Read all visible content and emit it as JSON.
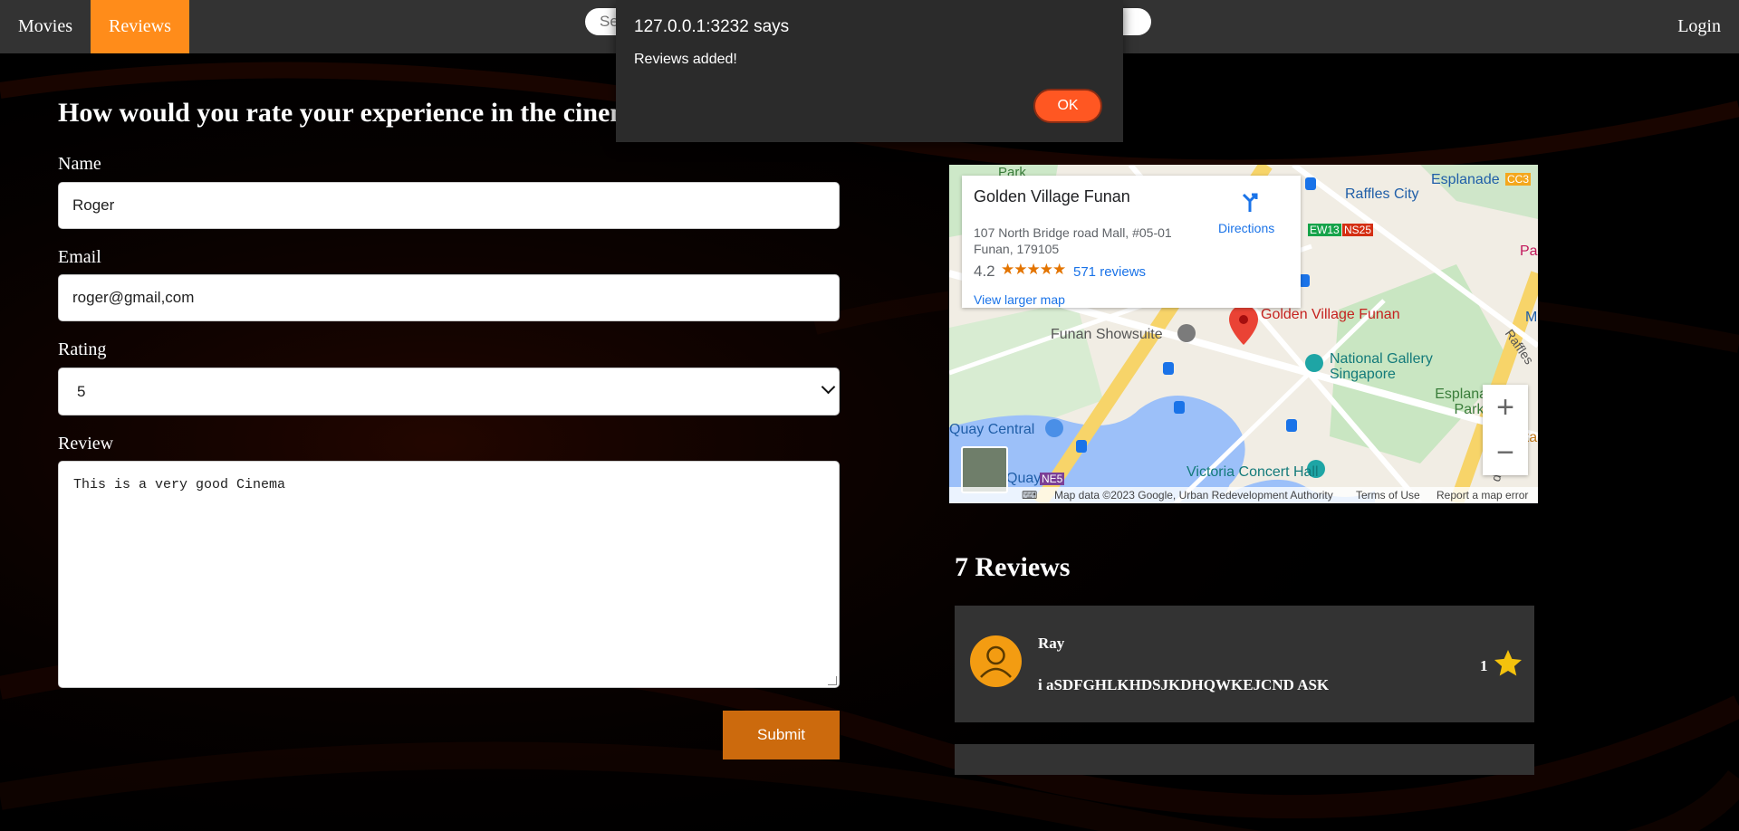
{
  "nav": {
    "movies": "Movies",
    "reviews": "Reviews",
    "login": "Login",
    "search_placeholder": "Search"
  },
  "form": {
    "heading": "How would you rate your experience in the cinema?",
    "name_label": "Name",
    "name_value": "Roger",
    "email_label": "Email",
    "email_value": "roger@gmail,com",
    "rating_label": "Rating",
    "rating_value": "5",
    "review_label": "Review",
    "review_value": "This is a very good Cinema",
    "submit": "Submit"
  },
  "map": {
    "place_name": "Golden Village Funan",
    "address": "107 North Bridge road Mall, #05-01 Funan, 179105",
    "rating": "4.2",
    "stars": "★★★★★",
    "reviews_link": "571 reviews",
    "directions": "Directions",
    "view_larger": "View larger map",
    "labels": {
      "park": "Park",
      "esplanade": "Esplanade",
      "cc3": "CC3",
      "raffles_city": "Raffles City",
      "ew13": "EW13",
      "ns25": "NS25",
      "pa": "Pa",
      "golden_village": "Golden Village Funan",
      "funan": "Funan Showsuite",
      "national_gallery": "National Gallery Singapore",
      "raffles": "Raffles",
      "m": "M",
      "esplanade_park": "Esplanade Park",
      "quay_central": "Quay Central",
      "victoria": "Victoria Concert Hall",
      "maka": "Maka",
      "quay": "Quay",
      "ne5": "NE5",
      "de_dr": "de Dr"
    },
    "attribution": "Map data ©2023 Google, Urban Redevelopment Authority",
    "terms": "Terms of Use",
    "report": "Report a map error",
    "zoom_in": "+",
    "zoom_out": "−"
  },
  "reviews": {
    "title": "7 Reviews",
    "items": [
      {
        "name": "Ray",
        "text": "i aSDFGHLKHDSJKDHQWKEJCND ASK",
        "rating": "1"
      }
    ]
  },
  "dialog": {
    "title": "127.0.0.1:3232 says",
    "message": "Reviews added!",
    "ok": "OK"
  },
  "colors": {
    "nav_bg": "#333333",
    "active_tab": "#ff8c1a",
    "submit_bg": "#cc6a0d",
    "dialog_ok": "#ff5722",
    "star": "#f4c20d"
  }
}
